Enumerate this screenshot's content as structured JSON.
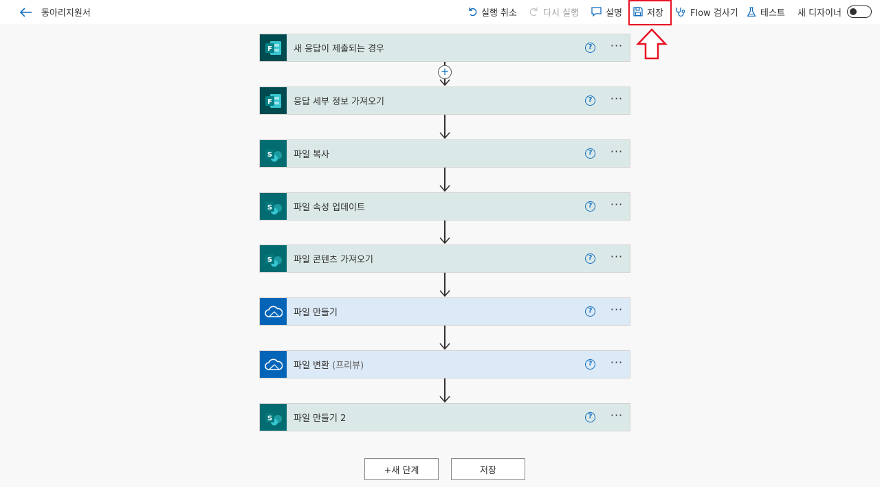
{
  "header": {
    "flow_title": "동아리지원서",
    "commands": {
      "undo": "실행 취소",
      "redo": "다시 실행",
      "comment": "설명",
      "save": "저장",
      "checker": "Flow 검사기",
      "test": "테스트",
      "new_designer": "새 디자이너"
    },
    "new_designer_enabled": false
  },
  "steps": [
    {
      "title": "새 응답이 제출되는 경우",
      "connector": "forms",
      "icon": "forms-icon"
    },
    {
      "title": "응답 세부 정보 가져오기",
      "connector": "forms",
      "icon": "forms-icon"
    },
    {
      "title": "파일 복사",
      "connector": "sharepoint",
      "icon": "sharepoint-icon"
    },
    {
      "title": "파일 속성 업데이트",
      "connector": "sharepoint",
      "icon": "sharepoint-icon"
    },
    {
      "title": "파일 콘텐츠 가져오기",
      "connector": "sharepoint",
      "icon": "sharepoint-icon"
    },
    {
      "title": "파일 만들기",
      "connector": "onedrive",
      "icon": "onedrive-icon"
    },
    {
      "title": "파일 변환",
      "subtitle": "(프리뷰)",
      "connector": "onedrive",
      "icon": "onedrive-icon"
    },
    {
      "title": "파일 만들기 2",
      "connector": "sharepoint",
      "icon": "sharepoint-icon"
    }
  ],
  "step_help_label": "?",
  "step_more_label": "···",
  "insert_step_label": "+",
  "bottom_actions": {
    "new_step": "+새 단계",
    "save": "저장"
  },
  "colors": {
    "accent": "#0f6cbd",
    "highlight": "#e81123",
    "forms": "#004b50",
    "sharepoint": "#036c70",
    "onedrive": "#0364b8"
  }
}
